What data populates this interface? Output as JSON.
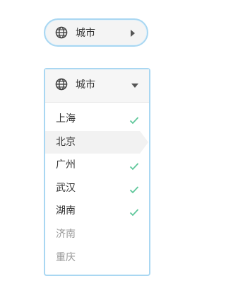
{
  "collapsed_selector": {
    "label": "城市",
    "icon": "globe-icon"
  },
  "dropdown": {
    "header_label": "城市",
    "items": [
      {
        "label": "上海",
        "checked": true
      },
      {
        "label": "北京",
        "checked": false,
        "hovered": true
      },
      {
        "label": "广州",
        "checked": true
      },
      {
        "label": "武汉",
        "checked": true
      },
      {
        "label": "湖南",
        "checked": true
      },
      {
        "label": "济南",
        "checked": false,
        "disabled": true
      },
      {
        "label": "重庆",
        "checked": false,
        "disabled": true
      }
    ]
  },
  "colors": {
    "accent_border": "#a9d7f2",
    "check": "#5ec79a"
  }
}
